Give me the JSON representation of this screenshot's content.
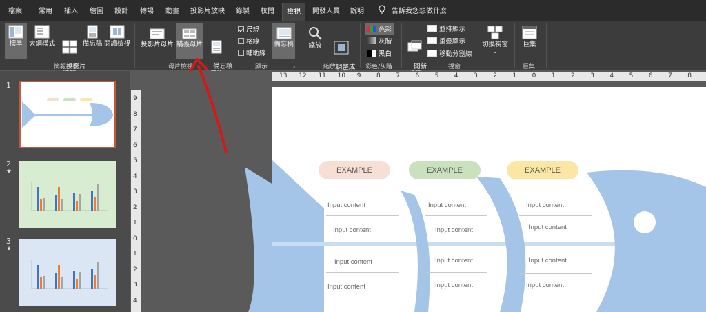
{
  "tabs": [
    "檔案",
    "常用",
    "插入",
    "繪圖",
    "設計",
    "轉場",
    "動畫",
    "投影片放映",
    "錄製",
    "校閱",
    "檢視",
    "開發人員",
    "說明"
  ],
  "active_tab": "檢視",
  "tell_me": "告訴我您想做什麼",
  "ribbon": {
    "presentation_views": {
      "label": "簡報檢視",
      "buttons": [
        {
          "label": "標準",
          "icon": "normal-view-icon"
        },
        {
          "label": "大綱模式",
          "icon": "outline-view-icon"
        },
        {
          "label": "投影片\n瀏覽",
          "icon": "slide-sorter-icon"
        },
        {
          "label": "備忘稿",
          "icon": "notes-page-icon"
        },
        {
          "label": "閱讀檢視",
          "icon": "reading-view-icon"
        }
      ]
    },
    "master_views": {
      "label": "母片檢視",
      "buttons": [
        {
          "label": "投影片母片",
          "icon": "slide-master-icon"
        },
        {
          "label": "講義母片",
          "icon": "handout-master-icon"
        },
        {
          "label": "備忘稿\n母片",
          "icon": "notes-master-icon"
        }
      ]
    },
    "show": {
      "label": "顯示",
      "checks": [
        {
          "label": "尺規",
          "checked": true
        },
        {
          "label": "格線",
          "checked": false
        },
        {
          "label": "輔助線",
          "checked": false
        }
      ],
      "notes": "備忘稿"
    },
    "zoom": {
      "label": "縮放",
      "zoom": "縮放",
      "fit": "調整成\n視窗大小"
    },
    "color": {
      "label": "彩色/灰階",
      "items": [
        "色彩",
        "灰階",
        "黑白"
      ]
    },
    "window": {
      "label": "視窗",
      "new_window": "開新\n視窗",
      "items": [
        "並排顯示",
        "重疊顯示",
        "移動分割線"
      ],
      "switch": "切換視窗"
    },
    "macros": {
      "label": "巨集",
      "button": "巨集"
    }
  },
  "slides": [
    {
      "number": "1",
      "star": ""
    },
    {
      "number": "2",
      "star": "★"
    },
    {
      "number": "3",
      "star": "★"
    }
  ],
  "ruler_h": [
    "13",
    "12",
    "11",
    "10",
    "9",
    "8",
    "7",
    "6",
    "5",
    "4",
    "3",
    "2",
    "1",
    "0",
    "1",
    "2",
    "3",
    "4",
    "5",
    "6",
    "7",
    "8"
  ],
  "ruler_v": [
    "9",
    "8",
    "7",
    "6",
    "5",
    "4",
    "3",
    "2",
    "1",
    "0",
    "1",
    "2",
    "3",
    "4"
  ],
  "slide": {
    "pills": [
      "EXAMPLE",
      "EXAMPLE",
      "EXAMPLE"
    ],
    "input": "Input content"
  },
  "colors": {
    "pill1": "#f7e0d3",
    "pill2": "#c9e2bd",
    "pill3": "#fbe7a3",
    "fish": "#a4c4e8",
    "arrow": "#d11a1a"
  }
}
